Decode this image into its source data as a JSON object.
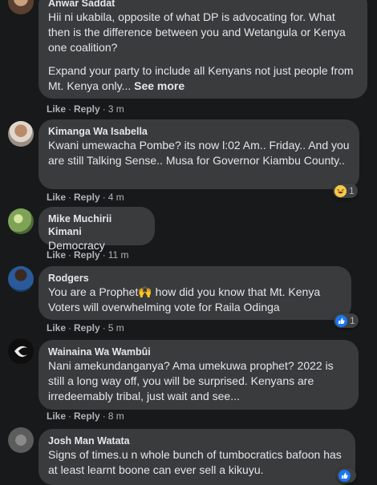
{
  "comments": [
    {
      "author": "Anwar Saddat",
      "paragraphs": [
        "Hii ni ukabila, opposite of what DP is advocating for. What then is the difference between you and Wetangula or Kenya one coalition?",
        "Expand your party to include all Kenyans not just people from Mt. Kenya only... "
      ],
      "see_more": "See more",
      "like": "Like",
      "reply": "Reply",
      "time": "3 m"
    },
    {
      "author": "Kimanga Wa Isabella",
      "text": "Kwani umewacha Pombe? its now l:02 Am.. Friday.. And you are still Talking Sense.. Musa for Governor Kiambu County..",
      "like": "Like",
      "reply": "Reply",
      "time": "4 m",
      "reaction": {
        "icon": "haha-emoji-icon",
        "count": "1"
      }
    },
    {
      "author": "Mike Muchirii Kimani",
      "text": "Democracy",
      "like": "Like",
      "reply": "Reply",
      "time": "11 m"
    },
    {
      "author": "Rodgers",
      "text": "You are a Prophet🙌 how did you know that Mt. Kenya Voters will overwhelming vote for Raila Odinga",
      "like": "Like",
      "reply": "Reply",
      "time": "5 m",
      "reaction": {
        "icon": "like-icon",
        "count": "1"
      }
    },
    {
      "author": "Wainaina Wa Wambûi",
      "text": "Nani amekundanganya? Ama umekuwa prophet? 2022 is still a long way off, you will be surprised. Kenyans are irredeemably tribal, just wait and see...",
      "like": "Like",
      "reply": "Reply",
      "time": "8 m"
    },
    {
      "author": "Josh Man Watata",
      "text": "Signs of times.u n whole bunch of tumbocratics bafoon has at least learnt boone can ever sell a kikuyu.",
      "reaction": {
        "icon": "like-icon",
        "count": ""
      }
    }
  ],
  "colors": {
    "background": "#18191a",
    "bubble": "#3a3b3c",
    "meta": "#b0b3b8",
    "like_blue": "#1877f2"
  }
}
